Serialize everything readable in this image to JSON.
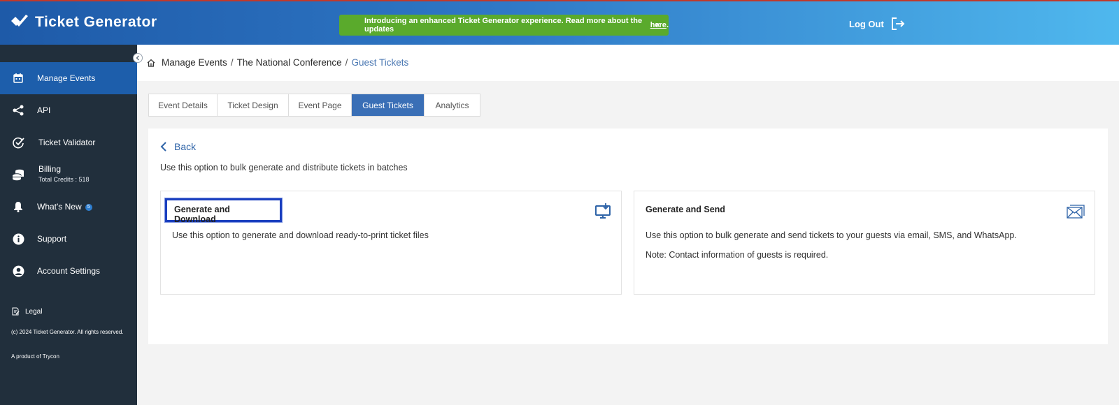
{
  "header": {
    "logo_text": "Ticket Generator",
    "banner_text": "Introducing an enhanced Ticket Generator experience. Read more about the updates",
    "banner_link": "here",
    "banner_period": ".",
    "banner_close": "×",
    "logout_label": "Log Out"
  },
  "sidebar": {
    "items": [
      {
        "label": "Manage Events",
        "icon": "calendar-icon",
        "active": true
      },
      {
        "label": "API",
        "icon": "share-nodes-icon"
      },
      {
        "label": "Ticket Validator",
        "icon": "check-circle-icon"
      },
      {
        "label": "Billing",
        "icon": "coins-icon",
        "sub": "Total Credits : 518"
      },
      {
        "label": "What's New",
        "icon": "bell-icon",
        "badge": "5"
      },
      {
        "label": "Support",
        "icon": "info-icon"
      },
      {
        "label": "Account Settings",
        "icon": "user-circle-icon"
      }
    ],
    "legal": "Legal",
    "copyright": "(c) 2024 Ticket Generator. All rights reserved.",
    "product": "A product of Trycon"
  },
  "breadcrumb": {
    "items": [
      "Manage Events",
      "The National Conference"
    ],
    "separator": "/",
    "current": "Guest Tickets"
  },
  "tabs": [
    {
      "label": "Event Details"
    },
    {
      "label": "Ticket Design"
    },
    {
      "label": "Event Page"
    },
    {
      "label": "Guest Tickets",
      "active": true
    },
    {
      "label": "Analytics"
    }
  ],
  "main": {
    "back_label": "Back",
    "intro": "Use this option to bulk generate and distribute tickets in batches",
    "cards": [
      {
        "title": "Generate and Download",
        "description": "Use this option to generate and download ready-to-print ticket files",
        "icon": "monitor-download-icon"
      },
      {
        "title": "Generate and Send",
        "description": "Use this option to bulk generate and send tickets to your guests via email, SMS, and WhatsApp.",
        "note": "Note: Contact information of guests is required.",
        "icon": "envelope-send-icon"
      }
    ]
  },
  "colors": {
    "header_start": "#1e5aa8",
    "header_end": "#4fb8ee",
    "banner": "#5aaa2c",
    "sidebar": "#212f3c",
    "sidebar_active": "#1d5eab",
    "tab_active": "#3a6fb6",
    "link": "#2f64a8"
  }
}
